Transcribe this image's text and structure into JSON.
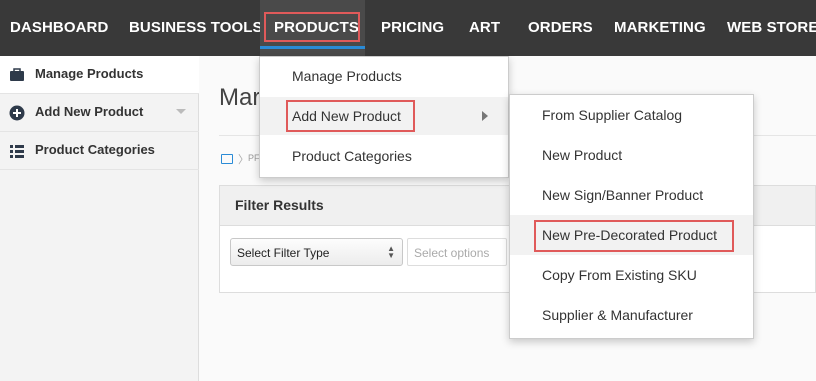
{
  "topnav": {
    "items": [
      {
        "label": "DASHBOARD"
      },
      {
        "label": "BUSINESS TOOLS"
      },
      {
        "label": "PRODUCTS"
      },
      {
        "label": "PRICING"
      },
      {
        "label": "ART"
      },
      {
        "label": "ORDERS"
      },
      {
        "label": "MARKETING"
      },
      {
        "label": "WEB STORES"
      }
    ],
    "active": "PRODUCTS"
  },
  "sidebar": {
    "items": [
      {
        "label": "Manage Products",
        "icon": "briefcase-icon"
      },
      {
        "label": "Add New Product",
        "icon": "plus-circle-icon"
      },
      {
        "label": "Product Categories",
        "icon": "list-icon"
      }
    ]
  },
  "main": {
    "title": "Mar",
    "breadcrumb": "PF",
    "filter_panel": {
      "title": "Filter Results",
      "filter_type": "Select Filter Type",
      "options_placeholder": "Select options"
    }
  },
  "products_menu": {
    "items": [
      {
        "label": "Manage Products"
      },
      {
        "label": "Add New Product"
      },
      {
        "label": "Product Categories"
      }
    ]
  },
  "add_new_submenu": {
    "items": [
      {
        "label": "From Supplier Catalog"
      },
      {
        "label": "New Product"
      },
      {
        "label": "New Sign/Banner Product"
      },
      {
        "label": "New Pre-Decorated Product"
      },
      {
        "label": "Copy From Existing SKU"
      },
      {
        "label": "Supplier & Manufacturer"
      }
    ]
  },
  "colors": {
    "nav_bg": "#393939",
    "accent": "#2a8bd6",
    "highlight_box": "#e05a5a"
  }
}
